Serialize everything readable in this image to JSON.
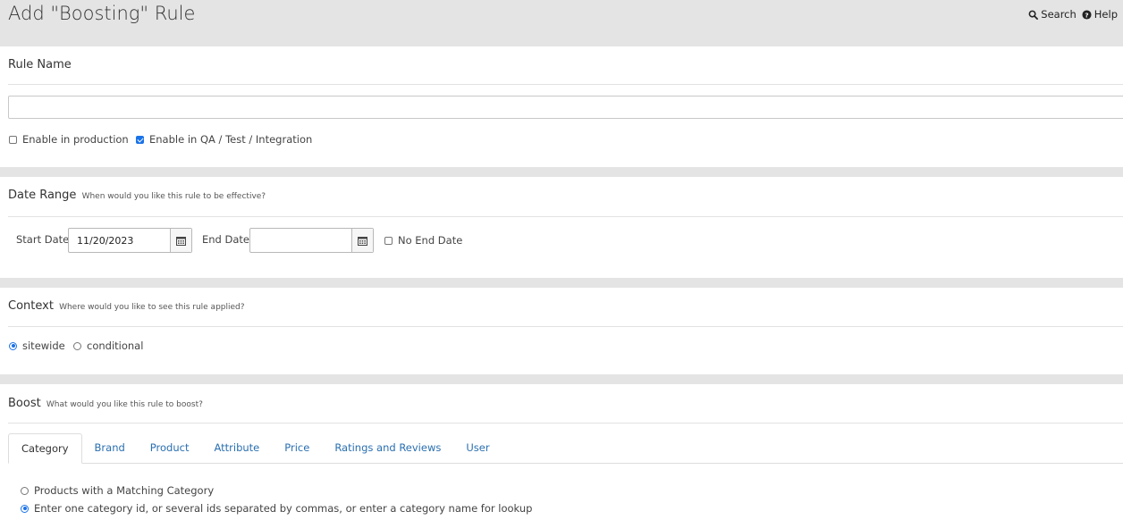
{
  "page": {
    "title": "Add \"Boosting\" Rule",
    "search_label": "Search",
    "help_label": "Help"
  },
  "rule_name": {
    "header": "Rule Name",
    "value": "",
    "enable_production_label": "Enable in production",
    "enable_production_checked": false,
    "enable_qa_label": "Enable in QA / Test / Integration",
    "enable_qa_checked": true
  },
  "date_range": {
    "header": "Date Range",
    "subheader": "When would you like this rule to be effective?",
    "start_label": "Start Date",
    "start_value": "11/20/2023",
    "end_label": "End Date",
    "end_value": "",
    "no_end_label": "No End Date",
    "no_end_checked": false
  },
  "context": {
    "header": "Context",
    "subheader": "Where would you like to see this rule applied?",
    "options": [
      {
        "label": "sitewide",
        "checked": true
      },
      {
        "label": "conditional",
        "checked": false
      }
    ]
  },
  "boost": {
    "header": "Boost",
    "subheader": "What would you like this rule to boost?",
    "tabs": [
      "Category",
      "Brand",
      "Product",
      "Attribute",
      "Price",
      "Ratings and Reviews",
      "User"
    ],
    "active_tab": "Category",
    "options": [
      {
        "label": "Products with a Matching Category",
        "checked": false
      },
      {
        "label": "Enter one category id, or several ids separated by commas, or enter a category name for lookup",
        "checked": true
      }
    ]
  },
  "colors": {
    "accent": "#1a73e8",
    "link": "#2a6fb0",
    "background": "#e4e4e4"
  }
}
